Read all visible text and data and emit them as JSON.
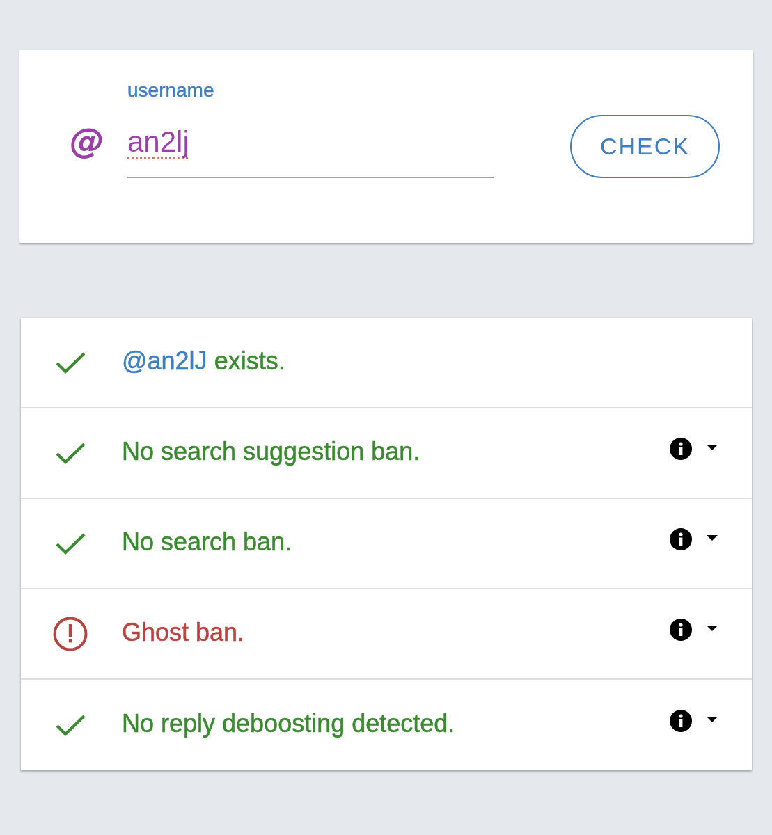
{
  "form": {
    "prefix": "@",
    "label": "username",
    "value": "an2lj",
    "misspelled": true,
    "button": "CHECK"
  },
  "results": [
    {
      "kind": "pass",
      "mention": "@an2lJ",
      "text": "exists.",
      "info": false
    },
    {
      "kind": "pass",
      "text": "No search suggestion ban.",
      "info": true
    },
    {
      "kind": "pass",
      "text": "No search ban.",
      "info": true
    },
    {
      "kind": "fail",
      "text": "Ghost ban.",
      "info": true
    },
    {
      "kind": "pass",
      "text": "No reply deboosting detected.",
      "info": true
    }
  ]
}
